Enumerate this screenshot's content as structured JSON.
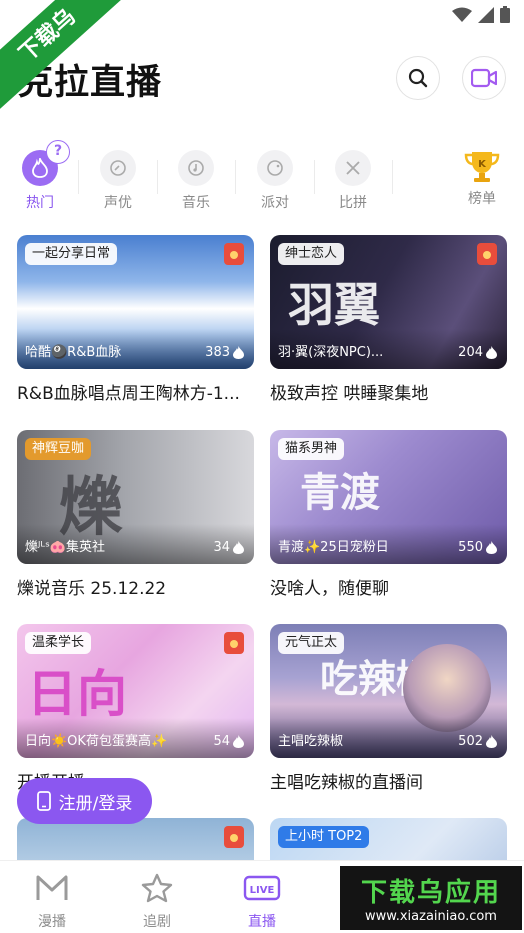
{
  "watermark": {
    "corner": "下载乌",
    "banner_big": "下载乌应用",
    "banner_small": "www.xiazainiao.com"
  },
  "header": {
    "title": "克拉直播",
    "search_icon": "search-icon",
    "video_icon": "video-camera-icon"
  },
  "categories": [
    {
      "label": "热门",
      "icon": "flame-icon",
      "active": true
    },
    {
      "label": "声优",
      "icon": "mic-icon"
    },
    {
      "label": "音乐",
      "icon": "music-note-icon"
    },
    {
      "label": "派对",
      "icon": "party-icon"
    },
    {
      "label": "比拼",
      "icon": "swords-icon"
    },
    {
      "label": "榜单",
      "icon": "trophy-icon"
    }
  ],
  "help_badge": "?",
  "rooms": [
    {
      "tag": "一起分享日常",
      "host": "哈酷🎱R&B血脉",
      "count": "383",
      "title": "R&B血脉唱点周王陶林方-1..."
    },
    {
      "tag": "绅士恋人",
      "host": "羽·翼(深夜NPC)...",
      "count": "204",
      "title": "极致声控 哄睡聚集地",
      "art": "羽翼"
    },
    {
      "tag": "神辉豆咖",
      "host": "爍ᴶᴸˢ🐽集英社",
      "count": "34",
      "title": "爍说音乐 25.12.22",
      "art": "爍"
    },
    {
      "tag": "猫系男神",
      "host": "青渡✨25日宠粉日",
      "count": "550",
      "title": "没啥人，随便聊",
      "art": "青渡"
    },
    {
      "tag": "温柔学长",
      "host": "日向☀️OK荷包蛋赛高✨",
      "count": "54",
      "title": "开播开播",
      "art": "日向"
    },
    {
      "tag": "元气正太",
      "host": "主唱吃辣椒",
      "count": "502",
      "title": "主唱吃辣椒的直播间",
      "art": "吃辣椒"
    },
    {
      "tag": ""
    },
    {
      "tag": "上小时 TOP2"
    }
  ],
  "login_button": "注册/登录",
  "nav": [
    {
      "label": "漫播",
      "icon": "manbo-logo-icon"
    },
    {
      "label": "追剧",
      "icon": "star-icon"
    },
    {
      "label": "直播",
      "icon": "live-icon",
      "active": true
    }
  ]
}
